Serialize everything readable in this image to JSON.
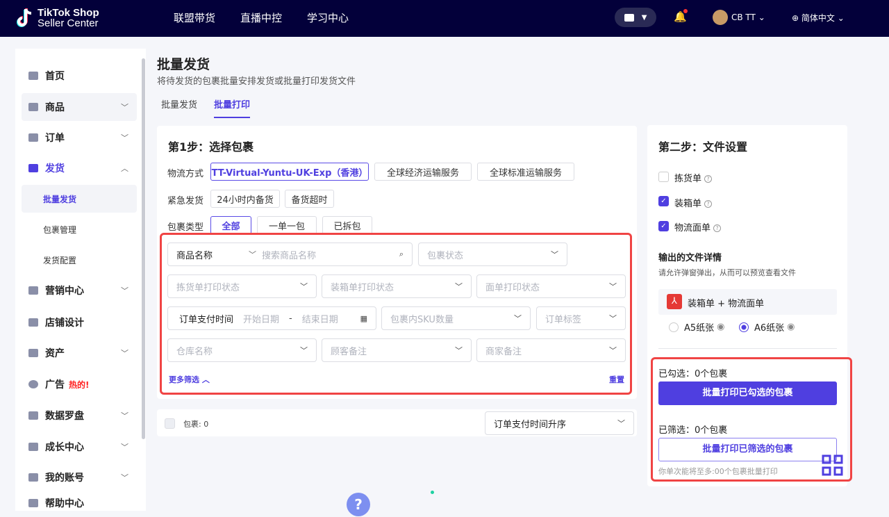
{
  "header": {
    "logo_line1": "TikTok Shop",
    "logo_line2": "Seller Center",
    "nav": [
      "联盟带货",
      "直播中控",
      "学习中心"
    ],
    "user": "CB TT",
    "language": "简体中文"
  },
  "sidebar": {
    "items": [
      {
        "label": "首页"
      },
      {
        "label": "商品"
      },
      {
        "label": "订单"
      },
      {
        "label": "发货"
      },
      {
        "label": "营销中心"
      },
      {
        "label": "店铺设计"
      },
      {
        "label": "资产"
      },
      {
        "label": "广告",
        "badge": "热的!"
      },
      {
        "label": "数据罗盘"
      },
      {
        "label": "成长中心"
      },
      {
        "label": "我的账号"
      },
      {
        "label": "帮助中心"
      }
    ],
    "sub": [
      "批量发货",
      "包裹管理",
      "发货配置"
    ]
  },
  "page": {
    "title": "批量发货",
    "subtitle": "将待发货的包裹批量安排发货或批量打印发货文件",
    "tabs": [
      "批量发货",
      "批量打印"
    ]
  },
  "step1": {
    "title": "第1步：选择包裹",
    "logistics_label": "物流方式",
    "logistics": [
      "TT-Virtual-Yuntu-UK-Exp（香港）",
      "全球经济运输服务",
      "全球标准运输服务"
    ],
    "urgent_label": "紧急发货",
    "urgent": [
      "24小时内备货",
      "备货超时"
    ],
    "type_label": "包裹类型",
    "types": [
      "全部",
      "一单一包",
      "已拆包"
    ],
    "filters": {
      "product_select": "商品名称",
      "search_placeholder": "搜索商品名称",
      "package_status": "包裹状态",
      "pick_status": "拣货单打印状态",
      "packing_status": "装箱单打印状态",
      "label_status": "面单打印状态",
      "pay_time": "订单支付时间",
      "start_date": "开始日期",
      "date_sep": "-",
      "end_date": "结束日期",
      "sku_count": "包裹内SKU数量",
      "order_tag": "订单标签",
      "warehouse": "仓库名称",
      "buyer_note": "顾客备注",
      "seller_note": "商家备注",
      "more": "更多筛选",
      "reset": "重置"
    }
  },
  "results": {
    "count_label": "包裹: 0",
    "sort": "订单支付时间升序"
  },
  "step2": {
    "title": "第二步：文件设置",
    "options": [
      {
        "label": "拣货单",
        "checked": false
      },
      {
        "label": "装箱单",
        "checked": true
      },
      {
        "label": "物流面单",
        "checked": true
      }
    ],
    "output_title": "输出的文件详情",
    "output_hint": "请允许弹窗弹出，从而可以预览查看文件",
    "file_name": "装箱单 + 物流面单",
    "paper": [
      "A5纸张",
      "A6纸张"
    ],
    "paper_selected": "A6纸张",
    "checked_count": "已勾选：0个包裹",
    "print_checked": "批量打印已勾选的包裹",
    "filtered_count": "已筛选：0个包裹",
    "print_filtered": "批量打印已筛选的包裹",
    "limit_note": "你单次能将至多:00个包裹批量打印"
  },
  "colors": {
    "accent": "#4f3fe0",
    "header": "#03003a",
    "highlight": "#f04444"
  }
}
